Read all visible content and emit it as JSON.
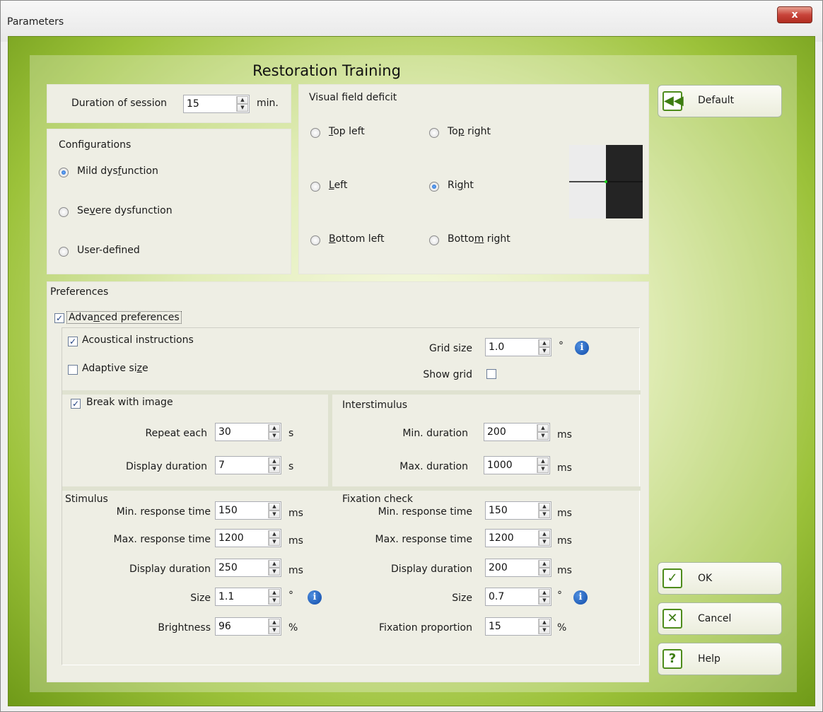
{
  "window": {
    "title": "Parameters",
    "close": "x"
  },
  "heading": "Restoration Training",
  "session": {
    "label": "Duration of session",
    "value": "15",
    "unit": "min."
  },
  "configurations": {
    "title": "Configurations",
    "options": [
      {
        "pre": "Mild dys",
        "u": "f",
        "post": "unction",
        "selected": true
      },
      {
        "pre": "Se",
        "u": "v",
        "post": "ere dysfunction",
        "selected": false
      },
      {
        "pre": "User-def",
        "u": "i",
        "post": "ned",
        "selected": false
      }
    ]
  },
  "visual_field": {
    "title": "Visual field deficit",
    "options": [
      {
        "pre": "",
        "u": "T",
        "post": "op left",
        "selected": false
      },
      {
        "pre": "To",
        "u": "p",
        "post": " right",
        "selected": false
      },
      {
        "pre": "",
        "u": "L",
        "post": "eft",
        "selected": false
      },
      {
        "pre": "Ri",
        "u": "g",
        "post": "ht",
        "selected": true
      },
      {
        "pre": "",
        "u": "B",
        "post": "ottom left",
        "selected": false
      },
      {
        "pre": "Botto",
        "u": "m",
        "post": " right",
        "selected": false
      }
    ]
  },
  "buttons": {
    "default": "Default",
    "ok": "OK",
    "cancel": "Cancel",
    "help": "Help"
  },
  "preferences": {
    "title": "Preferences",
    "advanced": {
      "pre": "Adva",
      "u": "n",
      "post": "ced preferences",
      "checked": true
    },
    "acoustical": {
      "label": "Acoustical instructions",
      "checked": true
    },
    "adaptive": {
      "pre": "Adaptive si",
      "u": "z",
      "post": "e",
      "checked": false
    },
    "grid_size": {
      "label": "Grid size",
      "value": "1.0",
      "unit": "°"
    },
    "show_grid": {
      "label": "Show grid",
      "checked": false
    },
    "break_image": {
      "label": "Break with image",
      "checked": true
    },
    "repeat_each": {
      "label": "Repeat each",
      "value": "30",
      "unit": "s"
    },
    "break_display": {
      "label": "Display duration",
      "value": "7",
      "unit": "s"
    },
    "interstimulus": {
      "title": "Interstimulus",
      "min": {
        "label": "Min. duration",
        "value": "200",
        "unit": "ms"
      },
      "max": {
        "label": "Max. duration",
        "value": "1000",
        "unit": "ms"
      }
    },
    "stimulus": {
      "title": "Stimulus",
      "min_resp": {
        "label": "Min. response time",
        "value": "150",
        "unit": "ms"
      },
      "max_resp": {
        "label": "Max. response time",
        "value": "1200",
        "unit": "ms"
      },
      "display": {
        "label": "Display duration",
        "value": "250",
        "unit": "ms"
      },
      "size": {
        "label": "Size",
        "value": "1.1",
        "unit": "°"
      },
      "brightness": {
        "label": "Brightness",
        "value": "96",
        "unit": "%"
      }
    },
    "fixation": {
      "title": "Fixation check",
      "min_resp": {
        "label": "Min. response time",
        "value": "150",
        "unit": "ms"
      },
      "max_resp": {
        "label": "Max. response time",
        "value": "1200",
        "unit": "ms"
      },
      "display": {
        "label": "Display duration",
        "value": "200",
        "unit": "ms"
      },
      "size": {
        "label": "Size",
        "value": "0.7",
        "unit": "°"
      },
      "proportion": {
        "label": "Fixation proportion",
        "value": "15",
        "unit": "%"
      }
    }
  }
}
